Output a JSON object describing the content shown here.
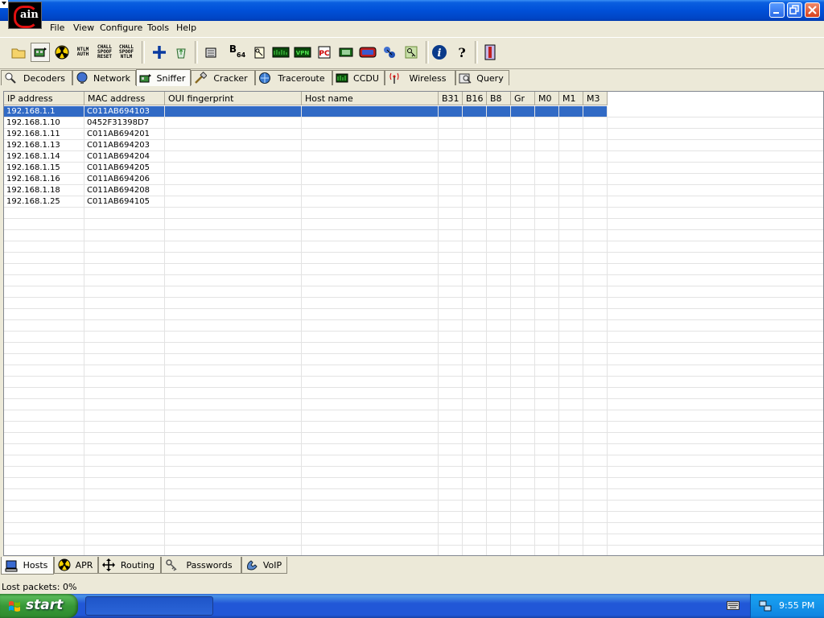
{
  "window": {
    "title": "",
    "app_logo_text": "ain"
  },
  "menu": [
    "File",
    "View",
    "Configure",
    "Tools",
    "Help"
  ],
  "toolbar": {
    "ntlm_auth": [
      "NTLM",
      "AUTH"
    ],
    "chall_spoof_reset": [
      "CHALL",
      "SPOOF",
      "RESET"
    ],
    "chall_spoof_ntlm": [
      "CHALL",
      "SPOOF",
      "NTLM"
    ],
    "b64_label": "B",
    "b64_sub": "64"
  },
  "top_tabs": [
    {
      "label": "Decoders",
      "icon": "decoder-icon"
    },
    {
      "label": "Network",
      "icon": "network-icon"
    },
    {
      "label": "Sniffer",
      "icon": "sniffer-icon",
      "active": true
    },
    {
      "label": "Cracker",
      "icon": "cracker-icon"
    },
    {
      "label": "Traceroute",
      "icon": "traceroute-icon"
    },
    {
      "label": "CCDU",
      "icon": "ccdu-icon"
    },
    {
      "label": "Wireless",
      "icon": "wireless-icon"
    },
    {
      "label": "Query",
      "icon": "query-icon"
    }
  ],
  "table": {
    "columns": [
      "IP address",
      "MAC address",
      "OUI fingerprint",
      "Host name",
      "B31",
      "B16",
      "B8",
      "Gr",
      "M0",
      "M1",
      "M3"
    ],
    "rows": [
      {
        "ip": "192.168.1.1",
        "mac": "C011AB694103",
        "selected": true
      },
      {
        "ip": "192.168.1.10",
        "mac": "0452F31398D7"
      },
      {
        "ip": "192.168.1.11",
        "mac": "C011AB694201"
      },
      {
        "ip": "192.168.1.13",
        "mac": "C011AB694203"
      },
      {
        "ip": "192.168.1.14",
        "mac": "C011AB694204"
      },
      {
        "ip": "192.168.1.15",
        "mac": "C011AB694205"
      },
      {
        "ip": "192.168.1.16",
        "mac": "C011AB694206"
      },
      {
        "ip": "192.168.1.18",
        "mac": "C011AB694208"
      },
      {
        "ip": "192.168.1.25",
        "mac": "C011AB694105"
      }
    ]
  },
  "bottom_tabs": [
    {
      "label": "Hosts",
      "icon": "computer-icon",
      "active": true
    },
    {
      "label": "APR",
      "icon": "radiation-icon"
    },
    {
      "label": "Routing",
      "icon": "move-arrows-icon"
    },
    {
      "label": "Passwords",
      "icon": "keys-icon"
    },
    {
      "label": "VoIP",
      "icon": "voip-icon"
    }
  ],
  "status": {
    "text": "Lost packets:  0%"
  },
  "taskbar": {
    "start_label": "start",
    "clock": "9:55 PM"
  },
  "colors": {
    "selection": "#316ac5",
    "title_blue": "#0050d8",
    "start_green": "#379837"
  }
}
